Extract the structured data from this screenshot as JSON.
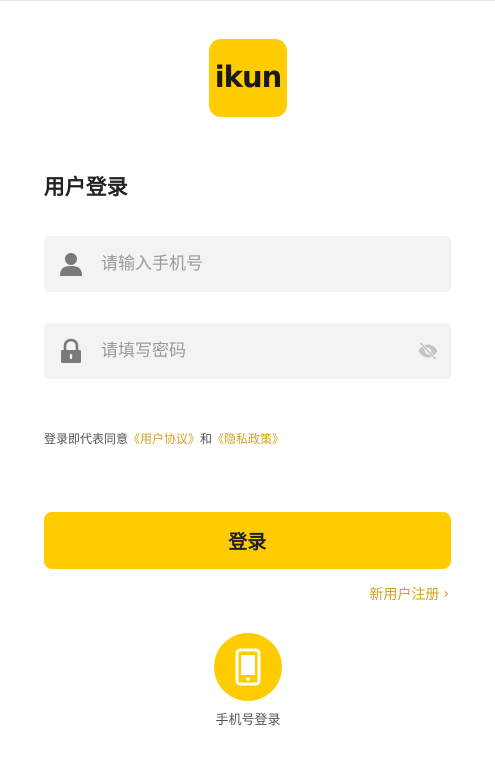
{
  "logo": {
    "text": "ikun"
  },
  "title": "用户登录",
  "phone_field": {
    "placeholder": "请输入手机号",
    "value": "",
    "icon": "user-icon"
  },
  "password_field": {
    "placeholder": "请填写密码",
    "value": "",
    "icon": "lock-icon",
    "toggle_icon": "eye-off-icon"
  },
  "agreement": {
    "prefix": "登录即代表同意",
    "user_agreement": "《用户协议》",
    "and": "和",
    "privacy_policy": "《隐私政策》"
  },
  "login_button": {
    "label": "登录"
  },
  "register_link": {
    "label": "新用户注册",
    "chevron": "›"
  },
  "phone_login": {
    "label": "手机号登录",
    "icon": "smartphone-icon"
  },
  "colors": {
    "brand": "#ffcc00",
    "link": "#d4a21c",
    "field_bg": "#f3f3f3",
    "text": "#222222"
  }
}
